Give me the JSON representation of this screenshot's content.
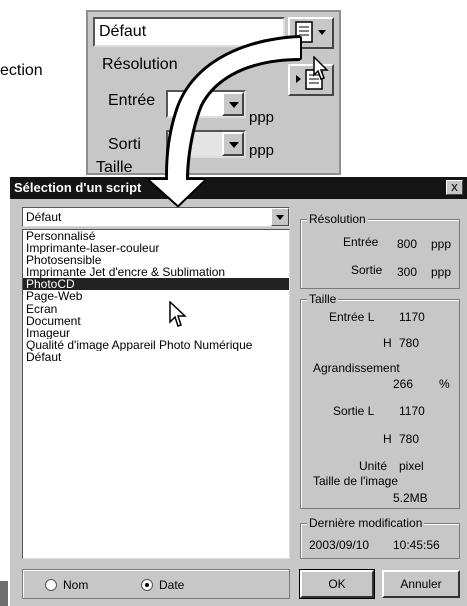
{
  "background": {
    "left_fragment": "ection",
    "preset_value": "Défaut",
    "resolution_label": "Résolution",
    "input_label": "Entrée",
    "output_label": "Sorti",
    "size_label": "Taille",
    "ppp_1": "ppp",
    "ppp_2": "ppp"
  },
  "dialog": {
    "title": "Sélection d'un script",
    "close_label": "x",
    "script_selected": "Défaut",
    "script_options": [
      "Personnalisé",
      "Imprimante-laser-couleur",
      "Photosensible",
      "Imprimante Jet d'encre & Sublimation",
      "PhotoCD",
      "Page-Web",
      "Ecran",
      "Document",
      "Imageur",
      "Qualité d'image Appareil Photo Numérique",
      "Défaut"
    ],
    "highlighted_option": "PhotoCD",
    "resolution": {
      "legend": "Résolution",
      "input_label": "Entrée",
      "input_value": "800",
      "input_unit": "ppp",
      "output_label": "Sortie",
      "output_value": "300",
      "output_unit": "ppp"
    },
    "size": {
      "legend": "Taille",
      "input_label": "Entrée L",
      "input_width": "1170",
      "input_h_label": "H",
      "input_height": "780",
      "magnification_label": "Agrandissement",
      "magnification_value": "266",
      "magnification_unit": "%",
      "output_label": "Sortie L",
      "output_width": "1170",
      "output_h_label": "H",
      "output_height": "780",
      "unit_label": "Unité",
      "unit_value": "pixel",
      "image_size_label": "Taille de l'image",
      "image_size_value": "5.2MB"
    },
    "last_modified": {
      "legend": "Dernière modification",
      "date": "2003/09/10",
      "time": "10:45:56"
    },
    "sort": {
      "name_label": "Nom",
      "date_label": "Date",
      "selected": "Date"
    },
    "ok_label": "OK",
    "cancel_label": "Annuler"
  }
}
